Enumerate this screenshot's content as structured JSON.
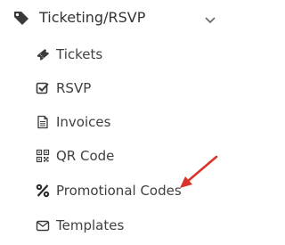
{
  "section": {
    "title": "Ticketing/RSVP",
    "icon": "tag-icon",
    "expand_icon": "chevron-down-icon"
  },
  "menu": {
    "items": [
      {
        "label": "Tickets",
        "icon": "ticket-icon"
      },
      {
        "label": "RSVP",
        "icon": "checkbox-icon"
      },
      {
        "label": "Invoices",
        "icon": "invoice-icon"
      },
      {
        "label": "QR Code",
        "icon": "qr-code-icon"
      },
      {
        "label": "Promotional Codes",
        "icon": "percent-icon"
      },
      {
        "label": "Templates",
        "icon": "envelope-icon"
      }
    ]
  },
  "colors": {
    "text": "#404040",
    "header_text": "#333333",
    "icon": "#3a3a3a",
    "annotation_arrow": "#d9342b"
  }
}
